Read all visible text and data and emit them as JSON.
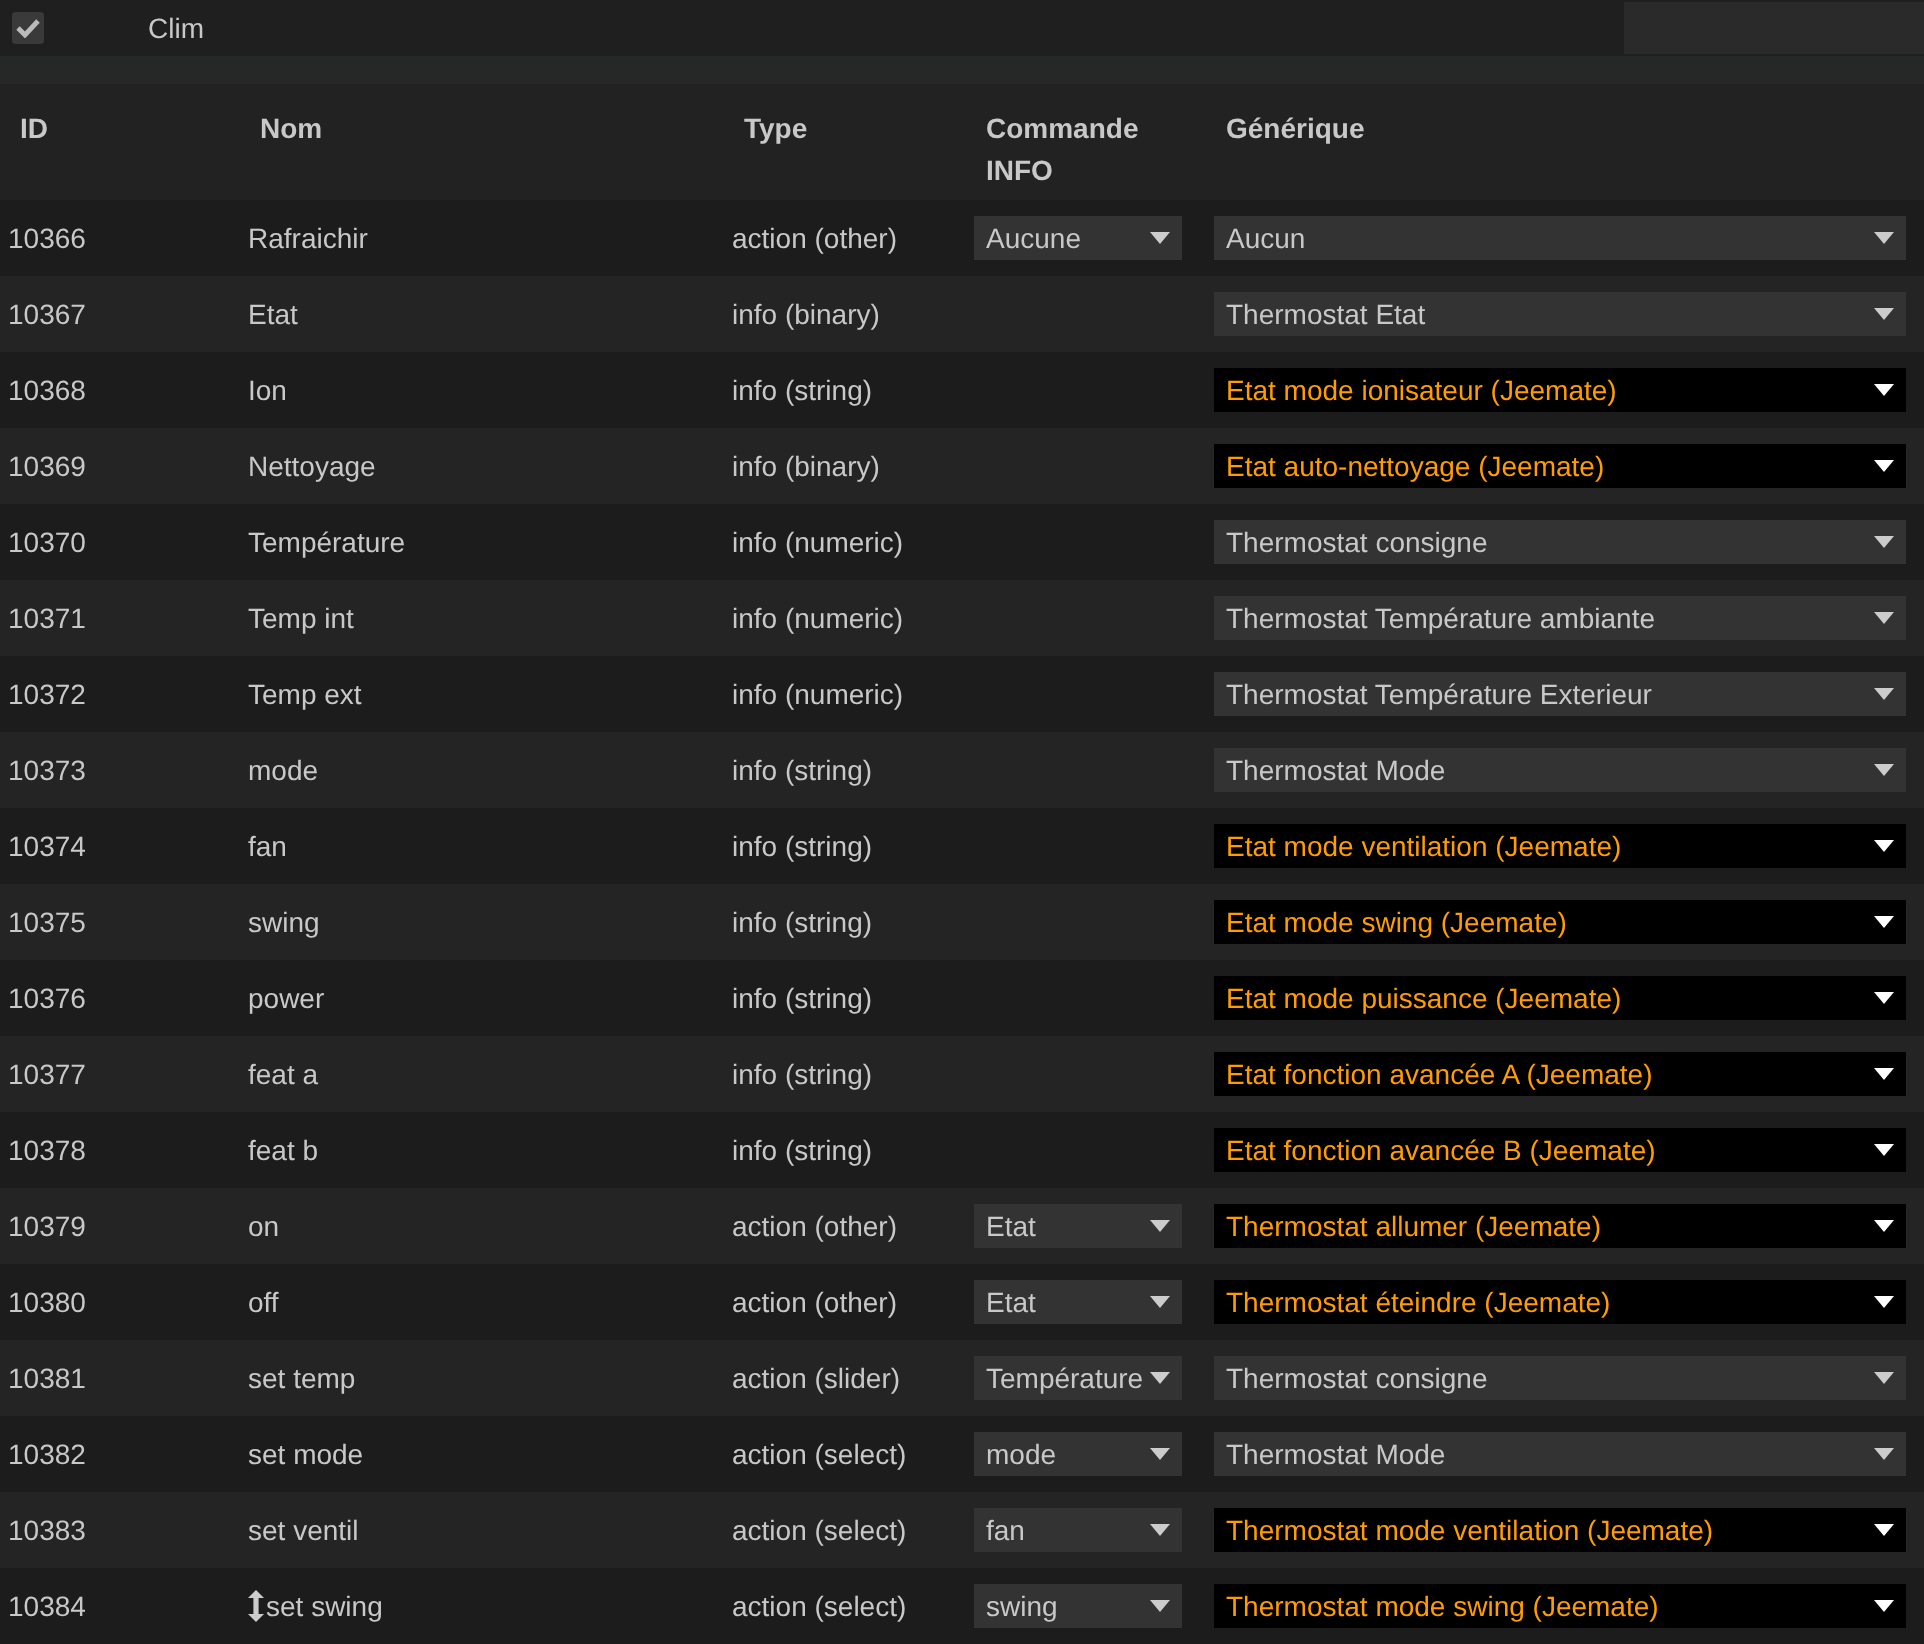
{
  "equipment": {
    "name": "Clim",
    "checked": true
  },
  "columns": [
    "ID",
    "Nom",
    "Type",
    "Commande INFO",
    "Générique"
  ],
  "rows": [
    {
      "id": "10366",
      "name": "Rafraichir",
      "type": "action (other)",
      "info": "Aucune",
      "generic": "Aucun",
      "highlighted": false
    },
    {
      "id": "10367",
      "name": "Etat",
      "type": "info (binary)",
      "generic": "Thermostat Etat",
      "highlighted": false
    },
    {
      "id": "10368",
      "name": "Ion",
      "type": "info (string)",
      "generic": "Etat mode ionisateur (Jeemate)",
      "highlighted": true
    },
    {
      "id": "10369",
      "name": "Nettoyage",
      "type": "info (binary)",
      "generic": "Etat auto-nettoyage (Jeemate)",
      "highlighted": true
    },
    {
      "id": "10370",
      "name": "Température",
      "type": "info (numeric)",
      "generic": "Thermostat consigne",
      "highlighted": false
    },
    {
      "id": "10371",
      "name": "Temp int",
      "type": "info (numeric)",
      "generic": "Thermostat Température ambiante",
      "highlighted": false
    },
    {
      "id": "10372",
      "name": "Temp ext",
      "type": "info (numeric)",
      "generic": "Thermostat Température Exterieur",
      "highlighted": false
    },
    {
      "id": "10373",
      "name": "mode",
      "type": "info (string)",
      "generic": "Thermostat Mode",
      "highlighted": false
    },
    {
      "id": "10374",
      "name": "fan",
      "type": "info (string)",
      "generic": "Etat mode ventilation (Jeemate)",
      "highlighted": true
    },
    {
      "id": "10375",
      "name": "swing",
      "type": "info (string)",
      "generic": "Etat mode swing (Jeemate)",
      "highlighted": true
    },
    {
      "id": "10376",
      "name": "power",
      "type": "info (string)",
      "generic": "Etat mode puissance (Jeemate)",
      "highlighted": true
    },
    {
      "id": "10377",
      "name": "feat a",
      "type": "info (string)",
      "generic": "Etat fonction avancée A (Jeemate)",
      "highlighted": true
    },
    {
      "id": "10378",
      "name": "feat b",
      "type": "info (string)",
      "generic": "Etat fonction avancée B (Jeemate)",
      "highlighted": true
    },
    {
      "id": "10379",
      "name": "on",
      "type": "action (other)",
      "info": "Etat",
      "generic": "Thermostat allumer (Jeemate)",
      "highlighted": true
    },
    {
      "id": "10380",
      "name": "off",
      "type": "action (other)",
      "info": "Etat",
      "generic": "Thermostat éteindre (Jeemate)",
      "highlighted": true
    },
    {
      "id": "10381",
      "name": "set temp",
      "type": "action (slider)",
      "info": "Température",
      "generic": "Thermostat consigne",
      "highlighted": false
    },
    {
      "id": "10382",
      "name": "set mode",
      "type": "action (select)",
      "info": "mode",
      "generic": "Thermostat Mode",
      "highlighted": false
    },
    {
      "id": "10383",
      "name": "set ventil",
      "type": "action (select)",
      "info": "fan",
      "generic": "Thermostat mode ventilation (Jeemate)",
      "highlighted": true
    },
    {
      "id": "10384",
      "name": "set swing",
      "type": "action (select)",
      "info": "swing",
      "generic": "Thermostat mode swing (Jeemate)",
      "highlighted": true,
      "pointer": true
    }
  ]
}
